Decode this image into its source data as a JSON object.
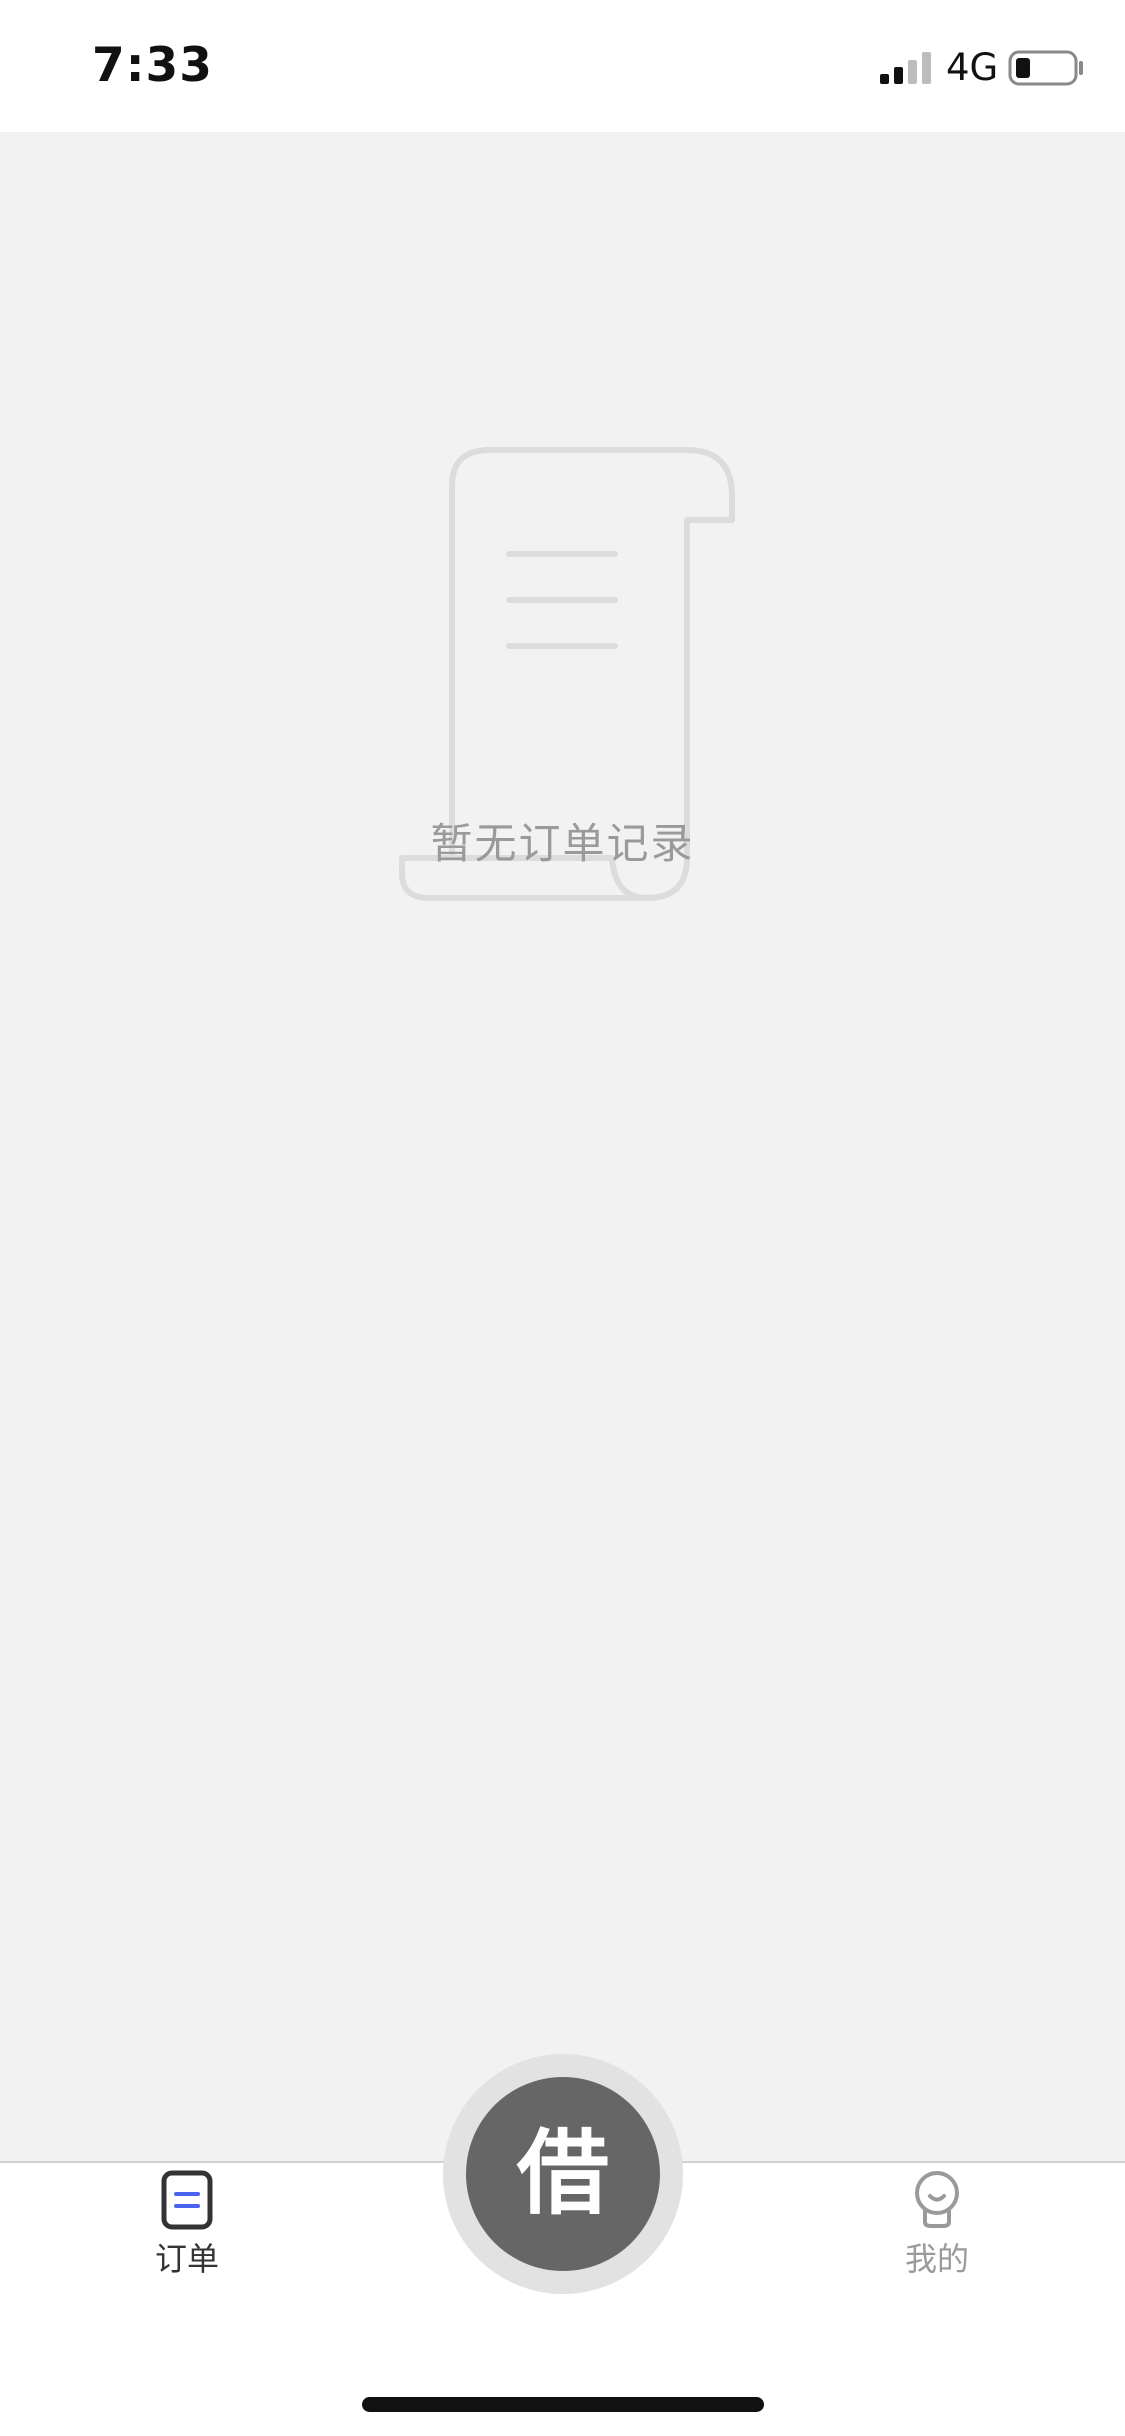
{
  "status_bar": {
    "time": "7:33",
    "network": "4G",
    "signal_bars_active": 2,
    "signal_bars_total": 4,
    "battery_level": 0.2
  },
  "empty_state": {
    "icon": "receipt-scroll-icon",
    "message": "暂无订单记录"
  },
  "tab_bar": {
    "orders": {
      "label": "订单",
      "icon": "orders-list-icon",
      "active": true
    },
    "borrow": {
      "label": "借",
      "icon": "borrow-button"
    },
    "mine": {
      "label": "我的",
      "icon": "user-profile-icon",
      "active": false
    }
  },
  "colors": {
    "page_background": "#f2f2f2",
    "accent_blue": "#4a62f0",
    "button_dark": "#666666",
    "text_muted": "#9a9a9a"
  }
}
